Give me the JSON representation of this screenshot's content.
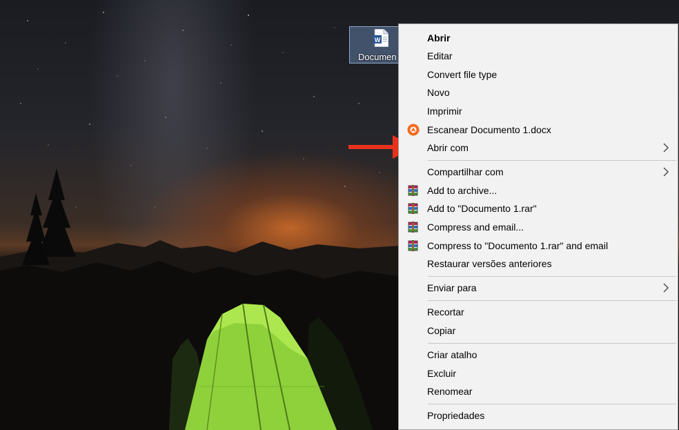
{
  "desktop": {
    "file_icon": {
      "name": "Documento 1.docx",
      "label": "Documen",
      "glyph_letter": "W"
    }
  },
  "context_menu": {
    "items": [
      {
        "id": "abrir",
        "label": "Abrir",
        "bold": true,
        "icon": "",
        "submenu": false
      },
      {
        "id": "editar",
        "label": "Editar",
        "bold": false,
        "icon": "",
        "submenu": false
      },
      {
        "id": "convert-file-type",
        "label": "Convert file type",
        "bold": false,
        "icon": "",
        "submenu": false
      },
      {
        "id": "novo",
        "label": "Novo",
        "bold": false,
        "icon": "",
        "submenu": false
      },
      {
        "id": "imprimir",
        "label": "Imprimir",
        "bold": false,
        "icon": "",
        "submenu": false
      },
      {
        "id": "escanear",
        "label": "Escanear Documento 1.docx",
        "bold": false,
        "icon": "avast-icon",
        "submenu": false
      },
      {
        "id": "abrir-com",
        "label": "Abrir com",
        "bold": false,
        "icon": "",
        "submenu": true
      },
      {
        "id": "compartilhar-com",
        "label": "Compartilhar com",
        "bold": false,
        "icon": "",
        "submenu": true
      },
      {
        "id": "add-to-archive",
        "label": "Add to archive...",
        "bold": false,
        "icon": "winrar-icon",
        "submenu": false
      },
      {
        "id": "add-to-rar",
        "label": "Add to \"Documento 1.rar\"",
        "bold": false,
        "icon": "winrar-icon",
        "submenu": false
      },
      {
        "id": "compress-email",
        "label": "Compress and email...",
        "bold": false,
        "icon": "winrar-icon",
        "submenu": false
      },
      {
        "id": "compress-rar-email",
        "label": "Compress to \"Documento 1.rar\" and email",
        "bold": false,
        "icon": "winrar-icon",
        "submenu": false
      },
      {
        "id": "restaurar-versoes",
        "label": "Restaurar versões anteriores",
        "bold": false,
        "icon": "",
        "submenu": false
      },
      {
        "id": "enviar-para",
        "label": "Enviar para",
        "bold": false,
        "icon": "",
        "submenu": true
      },
      {
        "id": "recortar",
        "label": "Recortar",
        "bold": false,
        "icon": "",
        "submenu": false
      },
      {
        "id": "copiar",
        "label": "Copiar",
        "bold": false,
        "icon": "",
        "submenu": false
      },
      {
        "id": "criar-atalho",
        "label": "Criar atalho",
        "bold": false,
        "icon": "",
        "submenu": false
      },
      {
        "id": "excluir",
        "label": "Excluir",
        "bold": false,
        "icon": "",
        "submenu": false
      },
      {
        "id": "renomear",
        "label": "Renomear",
        "bold": false,
        "icon": "",
        "submenu": false
      },
      {
        "id": "propriedades",
        "label": "Propriedades",
        "bold": false,
        "icon": "",
        "submenu": false
      }
    ]
  },
  "annotation": {
    "arrow_color": "#e8321e",
    "points_to": "abrir-com"
  },
  "colors": {
    "menu_bg": "#f2f2f2",
    "menu_border": "#a0a0a0",
    "separator": "#c8c8c8",
    "chevron": "#505050",
    "tent_green": "#8fd13a"
  }
}
